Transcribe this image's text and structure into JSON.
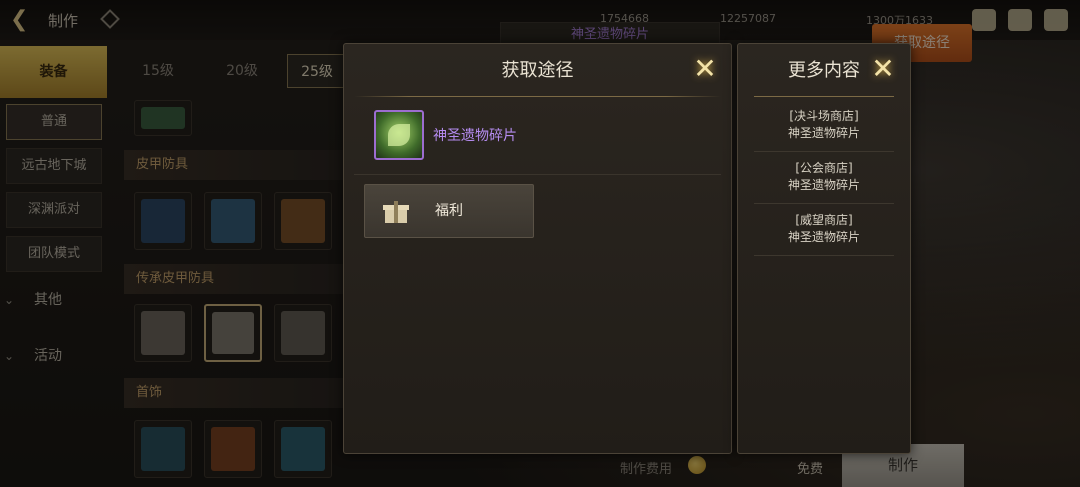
{
  "header": {
    "title": "制作",
    "currencies": [
      "1754668",
      "12257087",
      "1300万1633"
    ],
    "bg_get_path_label": "获取途径",
    "bg_item_label": "神圣遗物碎片"
  },
  "sidebar": {
    "main": "装备",
    "subs": [
      "普通",
      "远古地下城",
      "深渊派对",
      "团队模式"
    ],
    "cats": [
      "其他",
      "活动"
    ]
  },
  "level_tabs": [
    "15级",
    "20级",
    "25级"
  ],
  "sections": [
    "皮甲防具",
    "传承皮甲防具",
    "首饰"
  ],
  "bottom": {
    "cost_label": "制作费用",
    "free_label": "免费",
    "make_label": "制作"
  },
  "popup": {
    "title": "获取途径",
    "item_name": "神圣遗物碎片",
    "welfare_label": "福利"
  },
  "side_popup": {
    "title": "更多内容",
    "shops": [
      {
        "shop": "[决斗场商店]",
        "item": "神圣遗物碎片"
      },
      {
        "shop": "[公会商店]",
        "item": "神圣遗物碎片"
      },
      {
        "shop": "[威望商店]",
        "item": "神圣遗物碎片"
      }
    ]
  },
  "colors": {
    "accent_gold": "#c8b07a",
    "item_purple": "#b58cf0",
    "orange_button": "#e2772b"
  }
}
